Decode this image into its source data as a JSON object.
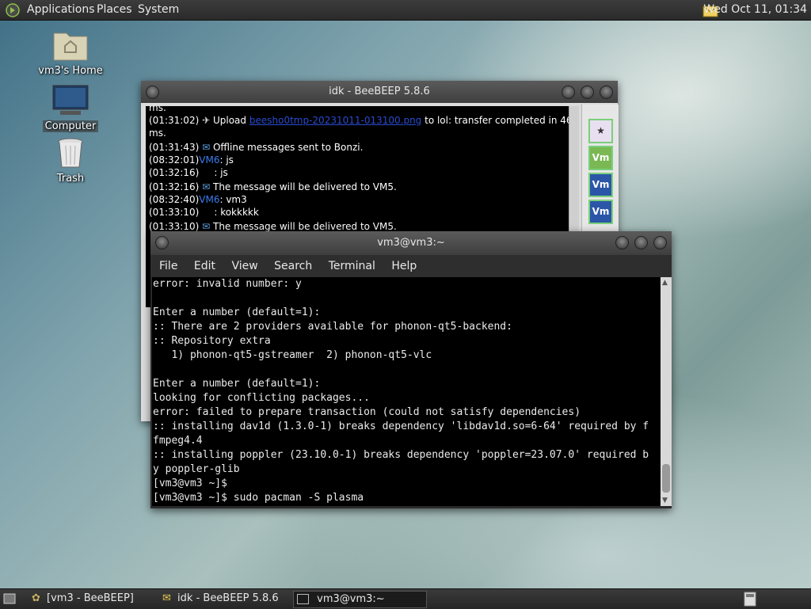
{
  "topbar": {
    "menus": [
      "Applications",
      "Places",
      "System"
    ],
    "clock": "Wed Oct 11, 01:34"
  },
  "desktop": {
    "icons": [
      {
        "label": "vm3's Home",
        "icon": "home-folder-icon"
      },
      {
        "label": "Computer",
        "icon": "computer-icon"
      },
      {
        "label": "Trash",
        "icon": "trash-icon"
      }
    ]
  },
  "beebeep_window": {
    "title": "idk - BeeBEEP 5.8.6",
    "chat_lines": [
      {
        "time": "",
        "text": "ms."
      },
      {
        "time": "(01:31:02)",
        "prefix": "Upload ",
        "link": "beesho0tmp-20231011-013100.png",
        "text": " to lol: transfer completed in 46"
      },
      {
        "time": "",
        "text": "ms."
      },
      {
        "time": "(01:31:43)",
        "text": "Offline messages sent to Bonzi."
      },
      {
        "time": "(08:32:01)",
        "user": "VM6",
        "text": ": js"
      },
      {
        "time": "(01:32:16)",
        "text": "     : js"
      },
      {
        "time": "(01:32:16)",
        "text": "The message will be delivered to VM5."
      },
      {
        "time": "(08:32:40)",
        "user": "VM6",
        "text": ": vm3"
      },
      {
        "time": "(01:33:10)",
        "text": "     : kokkkkk"
      },
      {
        "time": "(01:33:10)",
        "text": "The message will be delivered to VM5."
      }
    ],
    "avatars": [
      "Vm",
      "Vm",
      "Vm"
    ]
  },
  "terminal_window": {
    "title": "vm3@vm3:~",
    "menu": [
      "File",
      "Edit",
      "View",
      "Search",
      "Terminal",
      "Help"
    ],
    "lines": [
      "error: invalid number: y",
      "",
      "Enter a number (default=1):",
      ":: There are 2 providers available for phonon-qt5-backend:",
      ":: Repository extra",
      "   1) phonon-qt5-gstreamer  2) phonon-qt5-vlc",
      "",
      "Enter a number (default=1):",
      "looking for conflicting packages...",
      "error: failed to prepare transaction (could not satisfy dependencies)",
      ":: installing dav1d (1.3.0-1) breaks dependency 'libdav1d.so=6-64' required by f",
      "fmpeg4.4",
      ":: installing poppler (23.10.0-1) breaks dependency 'poppler=23.07.0' required b",
      "y poppler-glib",
      "[vm3@vm3 ~]$",
      "[vm3@vm3 ~]$ sudo pacman -S plasma"
    ]
  },
  "taskbar": {
    "tasks": [
      "[vm3 - BeeBEEP]",
      "idk - BeeBEEP 5.8.6",
      "vm3@vm3:~"
    ]
  }
}
